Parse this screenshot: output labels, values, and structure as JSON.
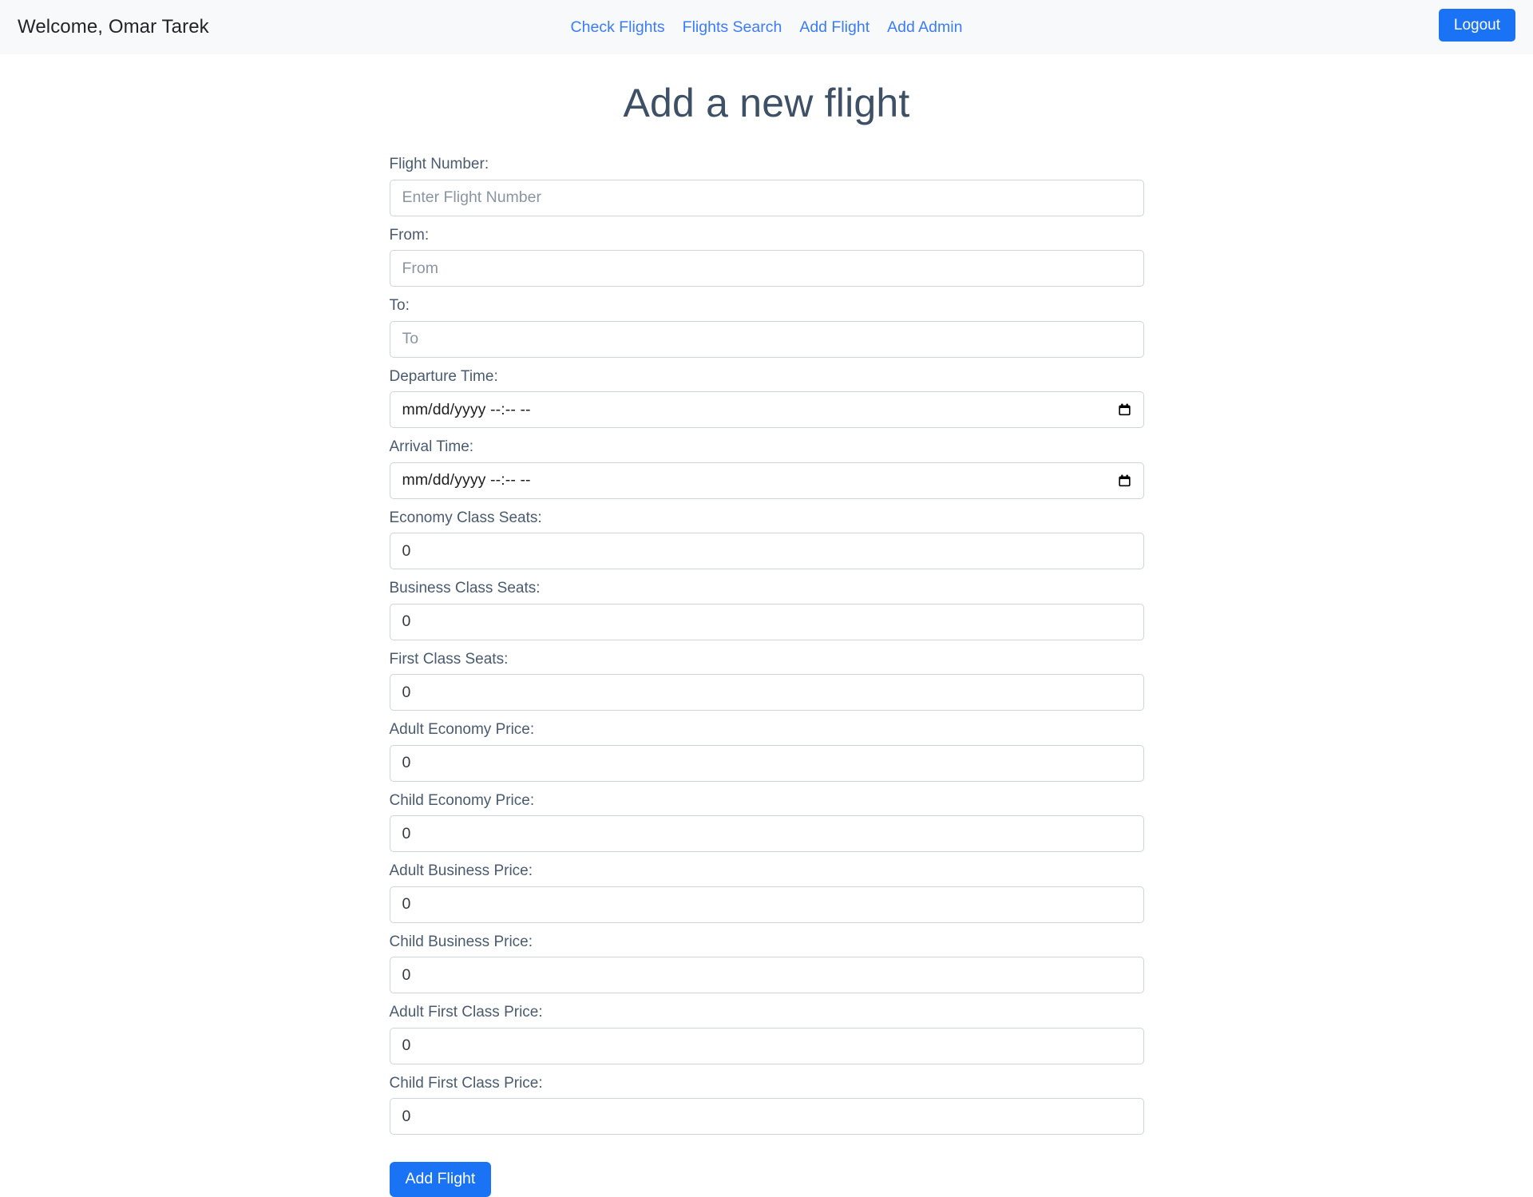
{
  "header": {
    "brand": "Welcome, Omar Tarek",
    "nav": [
      {
        "label": "Check Flights"
      },
      {
        "label": "Flights Search"
      },
      {
        "label": "Add Flight"
      },
      {
        "label": "Add Admin"
      }
    ],
    "logout_label": "Logout",
    "background": "#f8f9fa",
    "link_color": "#3b7cfa",
    "button_color": "#1a73f5"
  },
  "page": {
    "title": "Add a new flight",
    "title_color": "#3e5065"
  },
  "form": {
    "fields": [
      {
        "label": "Flight Number:",
        "type": "text",
        "value": "",
        "placeholder": "Enter Flight Number",
        "name": "flight-number"
      },
      {
        "label": "From:",
        "type": "text",
        "value": "",
        "placeholder": "From",
        "name": "from"
      },
      {
        "label": "To:",
        "type": "text",
        "value": "",
        "placeholder": "To",
        "name": "to"
      },
      {
        "label": "Departure Time:",
        "type": "datetime",
        "value": "mm/dd/yyyy --:-- --",
        "placeholder": "",
        "name": "departure-time"
      },
      {
        "label": "Arrival Time:",
        "type": "datetime",
        "value": "mm/dd/yyyy --:-- --",
        "placeholder": "",
        "name": "arrival-time"
      },
      {
        "label": "Economy Class Seats:",
        "type": "number",
        "value": "0",
        "placeholder": "",
        "name": "economy-class-seats"
      },
      {
        "label": "Business Class Seats:",
        "type": "number",
        "value": "0",
        "placeholder": "",
        "name": "business-class-seats"
      },
      {
        "label": "First Class Seats:",
        "type": "number",
        "value": "0",
        "placeholder": "",
        "name": "first-class-seats"
      },
      {
        "label": "Adult Economy Price:",
        "type": "number",
        "value": "0",
        "placeholder": "",
        "name": "adult-economy-price"
      },
      {
        "label": "Child Economy Price:",
        "type": "number",
        "value": "0",
        "placeholder": "",
        "name": "child-economy-price"
      },
      {
        "label": "Adult Business Price:",
        "type": "number",
        "value": "0",
        "placeholder": "",
        "name": "adult-business-price"
      },
      {
        "label": "Child Business Price:",
        "type": "number",
        "value": "0",
        "placeholder": "",
        "name": "child-business-price"
      },
      {
        "label": "Adult First Class Price:",
        "type": "number",
        "value": "0",
        "placeholder": "",
        "name": "adult-first-class-price"
      },
      {
        "label": "Child First Class Price:",
        "type": "number",
        "value": "0",
        "placeholder": "",
        "name": "child-first-class-price"
      }
    ],
    "submit_label": "Add Flight",
    "date_picker_icon": "calendar-icon"
  }
}
